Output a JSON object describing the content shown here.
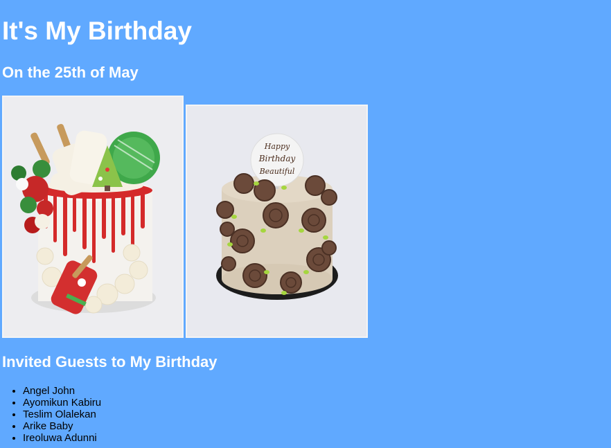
{
  "page": {
    "title": "It's My Birthday",
    "subtitle": "On the 25th of May",
    "background_color": "#60a9ff"
  },
  "gallery": {
    "images": [
      {
        "name": "drip-cake-photo",
        "icon": "cake-image"
      },
      {
        "name": "rosette-cake-photo",
        "icon": "cake-image",
        "topper_text": [
          "Happy",
          "Birthday",
          "Beautiful"
        ]
      }
    ]
  },
  "guests": {
    "heading": "Invited Guests to My Birthday",
    "list": [
      "Angel John",
      "Ayomikun Kabiru",
      "Teslim Olalekan",
      "Arike Baby",
      "Ireoluwa Adunni"
    ]
  }
}
